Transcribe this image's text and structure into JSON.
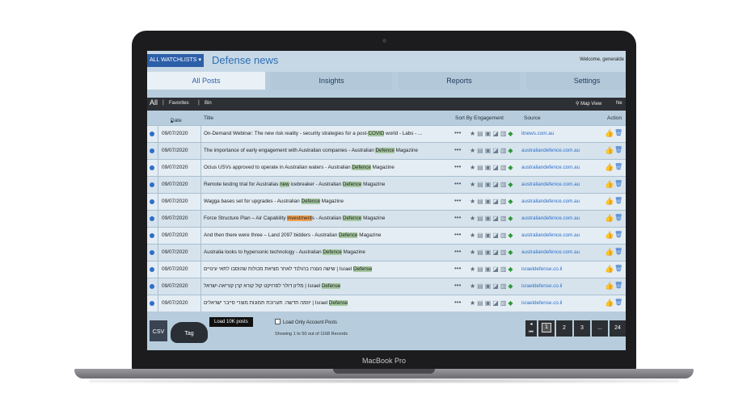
{
  "device": {
    "label": "MacBook Pro"
  },
  "header": {
    "watchlist_button": "ALL WATCHLISTS",
    "watchlist_name": "Defense news",
    "welcome": "Welcome, generalde"
  },
  "tabs": [
    {
      "label": "All Posts",
      "active": true
    },
    {
      "label": "Insights",
      "active": false
    },
    {
      "label": "Reports",
      "active": false
    },
    {
      "label": "Settings",
      "active": false
    }
  ],
  "filters": {
    "all": "All",
    "favorites": "Favorites",
    "bin": "Bin",
    "map_view": "Map View",
    "next": "Ne"
  },
  "table": {
    "columns": {
      "date": "Date",
      "title": "Title",
      "sort": "Sort By Engagement",
      "source": "Source",
      "actions": "Action"
    },
    "rows": [
      {
        "date": "09/07/2020",
        "title_parts": [
          "On-Demand Webinar: The new risk reality - security strategies for a post-",
          "COVID",
          " world - Labs - ..."
        ],
        "source": "itnews.com.au"
      },
      {
        "date": "09/07/2020",
        "title_parts": [
          "The importance of early engagement with Australian companies - Australian ",
          "Defence",
          " Magazine"
        ],
        "source": "australiandefence.com.au"
      },
      {
        "date": "09/07/2020",
        "title_parts": [
          "Ocius USVs approved to operate in Australian waters - Australian ",
          "Defence",
          " Magazine"
        ],
        "source": "australiandefence.com.au"
      },
      {
        "date": "09/07/2020",
        "title_parts": [
          "Remote testing trial for Australias ",
          "new",
          " icebreaker - Australian ",
          "Defence",
          " Magazine"
        ],
        "source": "australiandefence.com.au"
      },
      {
        "date": "09/07/2020",
        "title_parts": [
          "Wagga bases set for upgrades - Australian ",
          "Defence",
          " Magazine"
        ],
        "source": "australiandefence.com.au"
      },
      {
        "date": "09/07/2020",
        "title_parts": [
          "Force Structure Plan – Air Capability ",
          "investment",
          "s - Australian ",
          "Defence",
          " Magazine"
        ],
        "source": "australiandefence.com.au"
      },
      {
        "date": "09/07/2020",
        "title_parts": [
          "And then there were three – Land 2097 bidders - Australian ",
          "Defence",
          " Magazine"
        ],
        "source": "australiandefence.com.au"
      },
      {
        "date": "09/07/2020",
        "title_parts": [
          "Australia looks to hypersonic technology - Australian ",
          "Defence",
          " Magazine"
        ],
        "source": "australiandefence.com.au"
      },
      {
        "date": "09/07/2020",
        "title_parts": [
          "שישה נעצרו בהולנד לאחר מציאת מכולות שהוסבו לתאי עינויים | Israel ",
          "Defense",
          ""
        ],
        "source": "israeldefense.co.il"
      },
      {
        "date": "09/07/2020",
        "title_parts": [
          "מליון דולר לפרויקט קול קורא קרן קוריאה-ישראל | Israel ",
          "Defense",
          ""
        ],
        "source": "israeldefense.co.il"
      },
      {
        "date": "09/07/2020",
        "title_parts": [
          "יוזמה חדשה: תערוכת תמונות מוצרי סייבר ישראלים | Israel ",
          "Defense",
          ""
        ],
        "source": "israeldefense.co.il"
      }
    ]
  },
  "footer": {
    "csv": "CSV",
    "tag": "Tag",
    "load_10k": "Load 10K posts",
    "load_only": "Load Only Account Posts",
    "showing": "Showing 1 to 50 out of 1168 Records",
    "pages": [
      "1",
      "2",
      "3",
      "...",
      "24"
    ]
  },
  "icons": [
    "star-icon",
    "comment-icon",
    "image-icon",
    "share-icon",
    "note-icon",
    "tag-icon",
    "thumbs-up-icon",
    "trash-icon",
    "map-pin-icon",
    "caret-down-icon"
  ],
  "colors": {
    "accent": "#2d5fa8",
    "link": "#2d6ec9",
    "highlight": "#a6c8a0",
    "highlight_orange": "#f0a050"
  }
}
